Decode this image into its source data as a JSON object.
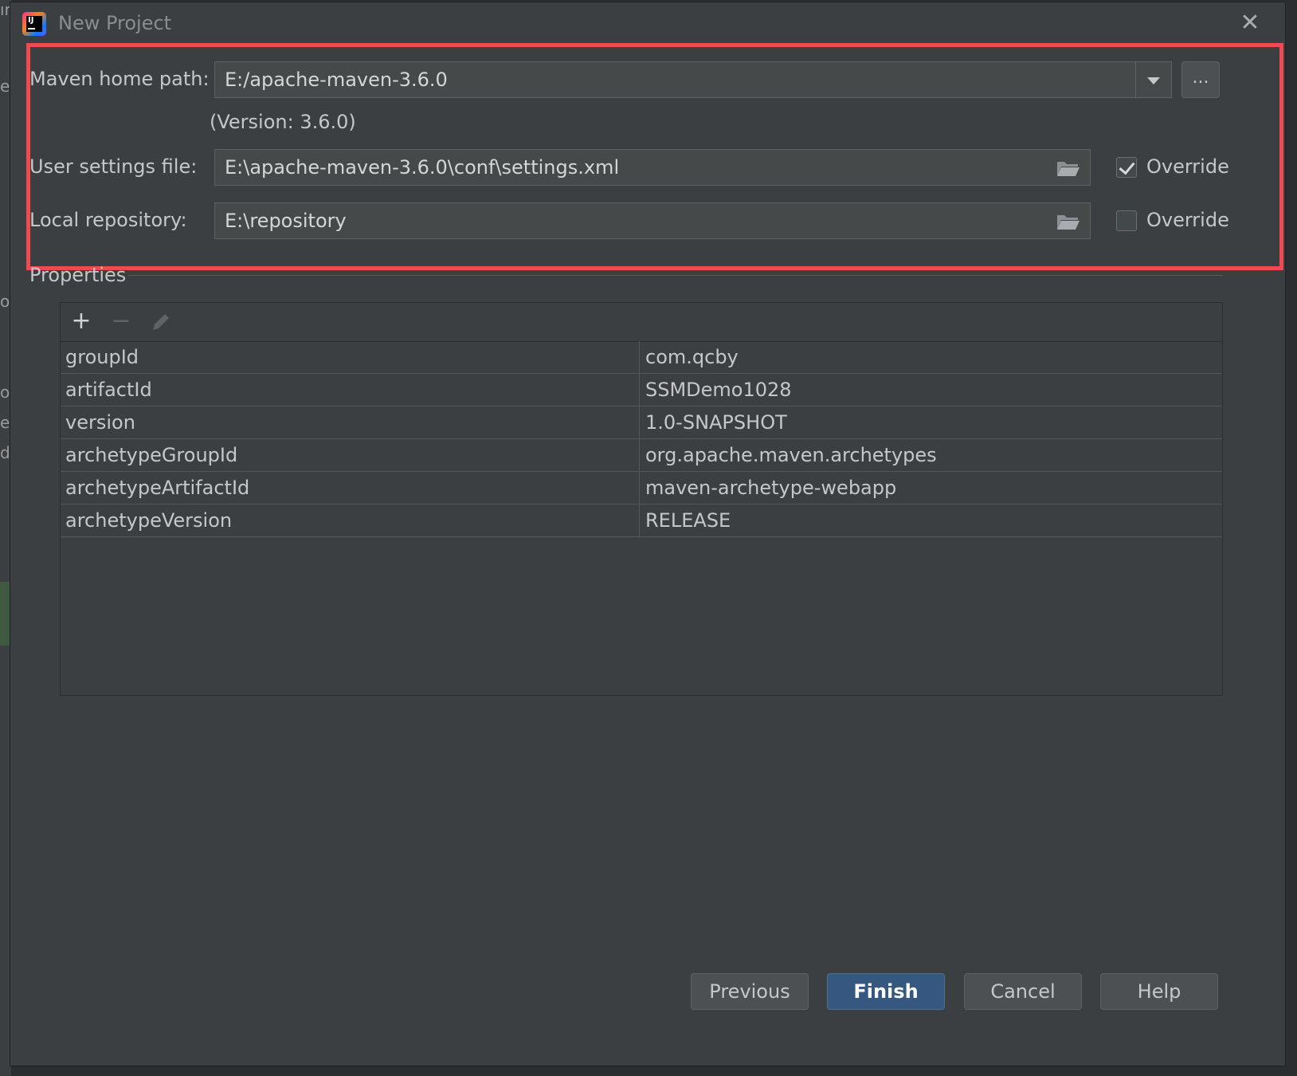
{
  "window": {
    "title": "New Project"
  },
  "background_fragments": [
    "ır",
    "e",
    "oı",
    "o",
    "er",
    "d."
  ],
  "maven": {
    "home_label": "Maven home path:",
    "home_value": "E:/apache-maven-3.6.0",
    "browse_label": "...",
    "version_text": "(Version: 3.6.0)",
    "settings_label": "User settings file:",
    "settings_value": "E:\\apache-maven-3.6.0\\conf\\settings.xml",
    "settings_override_label": "Override",
    "settings_override_checked": true,
    "repo_label": "Local repository:",
    "repo_value": "E:\\repository",
    "repo_override_label": "Override",
    "repo_override_checked": false
  },
  "properties": {
    "title": "Properties",
    "toolbar_icons": [
      "plus-icon",
      "minus-icon",
      "pencil-icon"
    ],
    "rows": [
      {
        "key": "groupId",
        "value": "com.qcby"
      },
      {
        "key": "artifactId",
        "value": "SSMDemo1028"
      },
      {
        "key": "version",
        "value": "1.0-SNAPSHOT"
      },
      {
        "key": "archetypeGroupId",
        "value": "org.apache.maven.archetypes"
      },
      {
        "key": "archetypeArtifactId",
        "value": "maven-archetype-webapp"
      },
      {
        "key": "archetypeVersion",
        "value": "RELEASE"
      }
    ]
  },
  "buttons": {
    "previous": "Previous",
    "finish": "Finish",
    "cancel": "Cancel",
    "help": "Help"
  },
  "colors": {
    "dialog_bg": "#3c3f41",
    "highlight": "#f04a50",
    "primary_button": "#365880"
  }
}
